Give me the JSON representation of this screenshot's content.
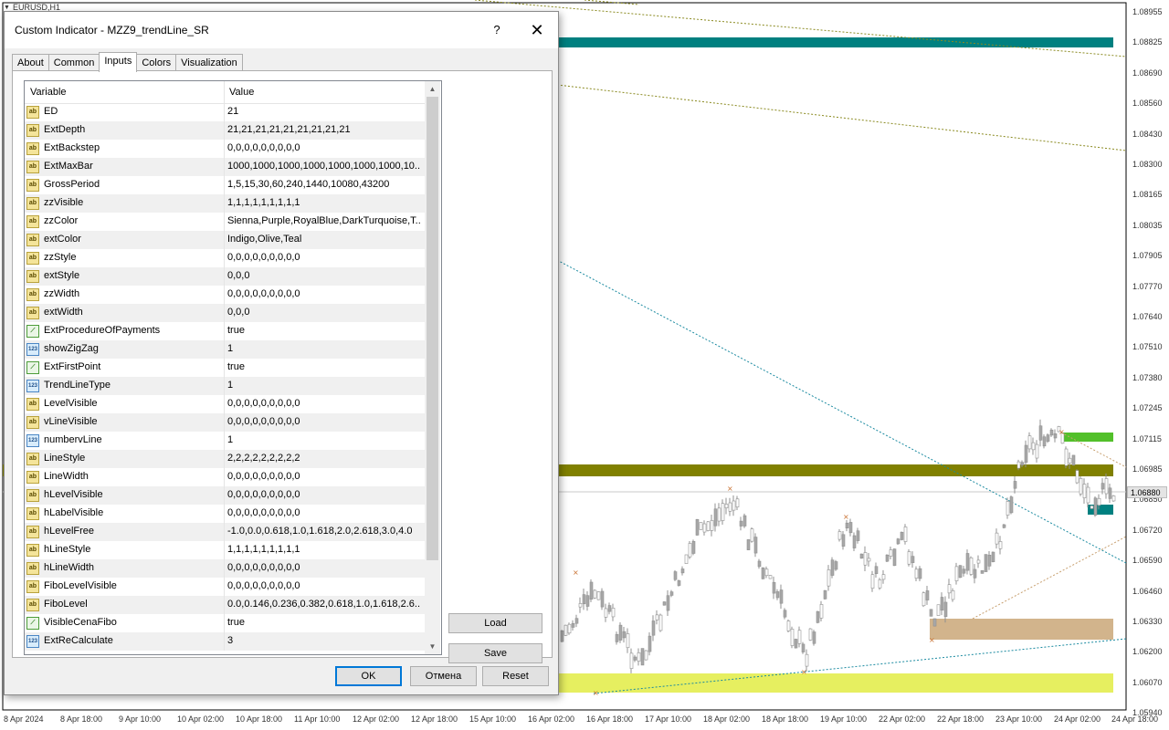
{
  "chart": {
    "symbol": "EURUSD,H1",
    "current_price": "1.06880",
    "price_labels": [
      "1.08955",
      "1.08825",
      "1.08690",
      "1.08560",
      "1.08430",
      "1.08300",
      "1.08165",
      "1.08035",
      "1.07905",
      "1.07770",
      "1.07640",
      "1.07510",
      "1.07380",
      "1.07245",
      "1.07115",
      "1.06985",
      "1.06850",
      "1.06720",
      "1.06590",
      "1.06460",
      "1.06330",
      "1.06200",
      "1.06070",
      "1.05940"
    ],
    "time_labels": [
      "8 Apr 2024",
      "8 Apr 18:00",
      "9 Apr 10:00",
      "10 Apr 02:00",
      "10 Apr 18:00",
      "11 Apr 10:00",
      "12 Apr 02:00",
      "12 Apr 18:00",
      "15 Apr 10:00",
      "16 Apr 02:00",
      "16 Apr 18:00",
      "17 Apr 10:00",
      "18 Apr 02:00",
      "18 Apr 18:00",
      "19 Apr 10:00",
      "22 Apr 02:00",
      "22 Apr 18:00",
      "23 Apr 10:00",
      "24 Apr 02:00",
      "24 Apr 18:00"
    ],
    "colors": {
      "teal_band": "#008080",
      "olive_band": "#808000",
      "yellow_band": "#e6ef60",
      "tan_box": "#d2b48c",
      "green_box": "#52c02a",
      "candles": "#a8a8a8",
      "trend_teal": "#1a8aa0",
      "trend_olive": "#8a8a20"
    }
  },
  "dialog": {
    "title": "Custom Indicator - MZZ9_trendLine_SR",
    "help": "?",
    "close": "✕",
    "tabs": [
      "About",
      "Common",
      "Inputs",
      "Colors",
      "Visualization"
    ],
    "active_tab": "Inputs",
    "columns": {
      "variable": "Variable",
      "value": "Value"
    },
    "params": [
      {
        "type": "ab",
        "name": "ED",
        "value": "21"
      },
      {
        "type": "ab",
        "name": "ExtDepth",
        "value": "21,21,21,21,21,21,21,21,21"
      },
      {
        "type": "ab",
        "name": "ExtBackstep",
        "value": "0,0,0,0,0,0,0,0,0"
      },
      {
        "type": "ab",
        "name": "ExtMaxBar",
        "value": "1000,1000,1000,1000,1000,1000,1000,10..."
      },
      {
        "type": "ab",
        "name": "GrossPeriod",
        "value": "1,5,15,30,60,240,1440,10080,43200"
      },
      {
        "type": "ab",
        "name": "zzVisible",
        "value": "1,1,1,1,1,1,1,1,1"
      },
      {
        "type": "ab",
        "name": "zzColor",
        "value": "Sienna,Purple,RoyalBlue,DarkTurquoise,T..."
      },
      {
        "type": "ab",
        "name": "extColor",
        "value": "Indigo,Olive,Teal"
      },
      {
        "type": "ab",
        "name": "zzStyle",
        "value": "0,0,0,0,0,0,0,0,0"
      },
      {
        "type": "ab",
        "name": "extStyle",
        "value": "0,0,0"
      },
      {
        "type": "ab",
        "name": "zzWidth",
        "value": "0,0,0,0,0,0,0,0,0"
      },
      {
        "type": "ab",
        "name": "extWidth",
        "value": "0,0,0"
      },
      {
        "type": "bool",
        "name": "ExtProcedureOfPayments",
        "value": "true"
      },
      {
        "type": "123",
        "name": "showZigZag",
        "value": "1"
      },
      {
        "type": "bool",
        "name": "ExtFirstPoint",
        "value": "true"
      },
      {
        "type": "123",
        "name": "TrendLineType",
        "value": "1"
      },
      {
        "type": "ab",
        "name": "LevelVisible",
        "value": "0,0,0,0,0,0,0,0,0"
      },
      {
        "type": "ab",
        "name": "vLineVisible",
        "value": "0,0,0,0,0,0,0,0,0"
      },
      {
        "type": "123",
        "name": "numbervLine",
        "value": "1"
      },
      {
        "type": "ab",
        "name": "LineStyle",
        "value": "2,2,2,2,2,2,2,2,2"
      },
      {
        "type": "ab",
        "name": "LineWidth",
        "value": "0,0,0,0,0,0,0,0,0"
      },
      {
        "type": "ab",
        "name": "hLevelVisible",
        "value": "0,0,0,0,0,0,0,0,0"
      },
      {
        "type": "ab",
        "name": "hLabelVisible",
        "value": "0,0,0,0,0,0,0,0,0"
      },
      {
        "type": "ab",
        "name": "hLevelFree",
        "value": "-1.0,0.0,0.618,1.0,1.618,2.0,2.618,3.0,4.0"
      },
      {
        "type": "ab",
        "name": "hLineStyle",
        "value": "1,1,1,1,1,1,1,1,1"
      },
      {
        "type": "ab",
        "name": "hLineWidth",
        "value": "0,0,0,0,0,0,0,0,0"
      },
      {
        "type": "ab",
        "name": "FiboLevelVisible",
        "value": "0,0,0,0,0,0,0,0,0"
      },
      {
        "type": "ab",
        "name": "FiboLevel",
        "value": "0.0,0.146,0.236,0.382,0.618,1.0,1.618,2.6..."
      },
      {
        "type": "bool",
        "name": "VisibleCenaFibo",
        "value": "true"
      },
      {
        "type": "123",
        "name": "ExtReCalculate",
        "value": "3"
      }
    ],
    "icon_labels": {
      "ab": "ab",
      "123": "123",
      "bool": "⟋"
    },
    "buttons": {
      "load": "Load",
      "save": "Save",
      "ok": "OK",
      "cancel": "Отмена",
      "reset": "Reset"
    }
  }
}
